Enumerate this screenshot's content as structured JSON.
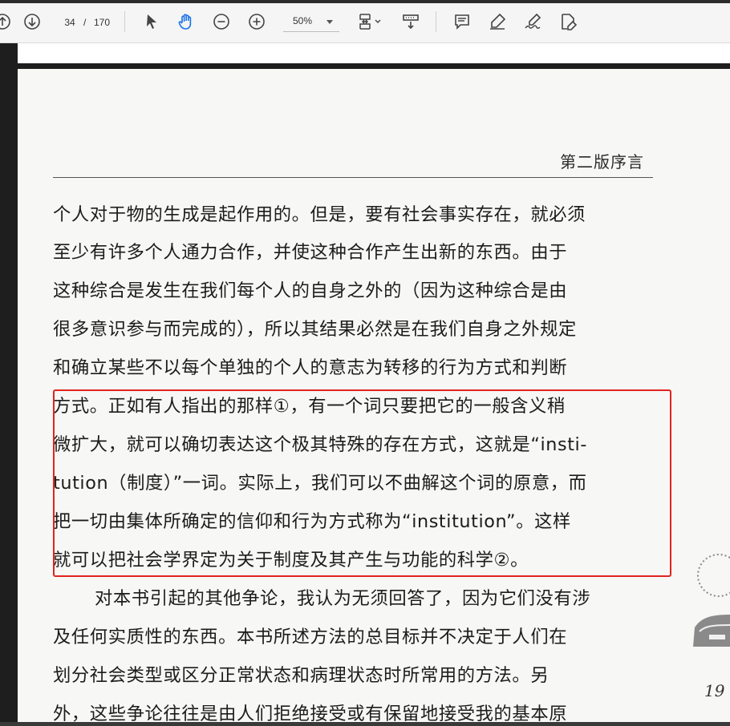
{
  "toolbar": {
    "current_page": "34",
    "page_separator": "/",
    "total_pages": "170",
    "zoom": "50%",
    "icons": [
      "page-up-icon",
      "page-down-icon",
      "select-arrow-icon",
      "hand-tool-icon",
      "zoom-out-icon",
      "zoom-in-icon",
      "fit-page-icon",
      "scroll-mode-icon",
      "comment-icon",
      "highlight-pen-icon",
      "sign-icon",
      "fill-sign-icon"
    ]
  },
  "document": {
    "running_header": "第二版序言",
    "lines": [
      "个人对于物的生成是起作用的。但是，要有社会事实存在，就必须",
      "至少有许多个人通力合作，并使这种合作产生出新的东西。由于",
      "这种综合是发生在我们每个人的自身之外的（因为这种综合是由",
      "很多意识参与而完成的），所以其结果必然是在我们自身之外规定",
      "和确立某些不以每个单独的个人的意志为转移的行为方式和判断",
      "方式。正如有人指出的那样①，有一个词只要把它的一般含义稍",
      "微扩大，就可以确切表达这个极其特殊的存在方式，这就是“insti-",
      "tution（制度）”一词。实际上，我们可以不曲解这个词的原意，而",
      "把一切由集体所确定的信仰和行为方式称为“institution”。这样",
      "就可以把社会学界定为关于制度及其产生与功能的科学②。",
      "对本书引起的其他争论，我认为无须回答了，因为它们没有涉",
      "及任何实质性的东西。本书所述方法的总目标并不决定于人们在",
      "划分社会类型或区分正常状态和病理状态时所常用的方法。另",
      "外，这些争论往往是由人们拒绝接受或有保留地接受我的基本原"
    ],
    "page_number": "19"
  },
  "colors": {
    "highlight_border": "#e0231f",
    "accent_blue": "#1a73e8"
  }
}
